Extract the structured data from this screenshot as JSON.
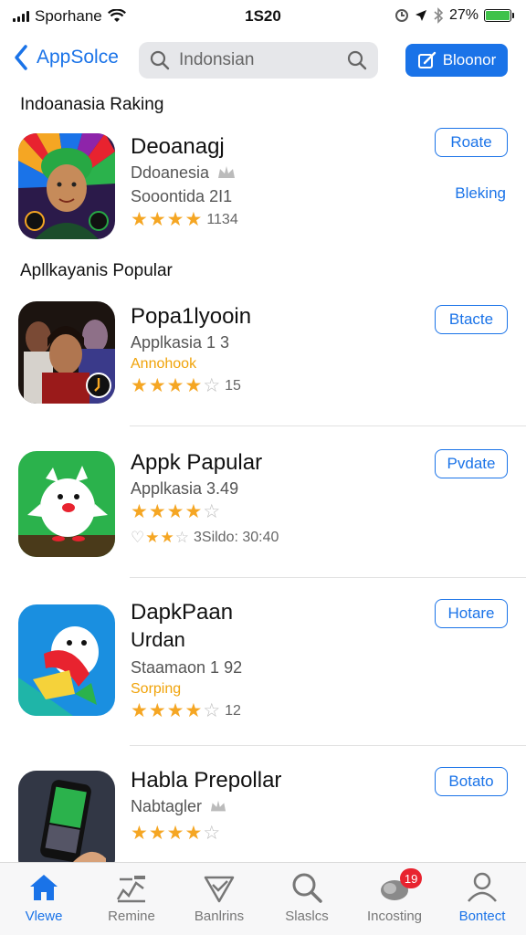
{
  "status_bar": {
    "carrier": "Sporhane",
    "time": "1S20",
    "battery_percent": "27%"
  },
  "nav": {
    "back_label": "AppSolce",
    "search_query": "Indonsian",
    "action_button": "Bloonor"
  },
  "sections": {
    "ranking_title": "Indoanasia Raking",
    "popular_title": "Apllkayanis Popular"
  },
  "featured": {
    "title": "Deoanagj",
    "subtitle": "Ddoanesia",
    "meta": "Sooontida 2I1",
    "rating": 4,
    "rating_count": "1134",
    "button": "Roate",
    "side_link": "Bleking"
  },
  "apps": [
    {
      "title": "Popa1lyooin",
      "subtitle": "Applkasia 1 3",
      "tag": "Annohook",
      "rating": 4,
      "rating_count": "15",
      "button": "Btacte"
    },
    {
      "title": "Appk Papular",
      "subtitle": "Applkasia 3.49",
      "rating": 4,
      "extra_rating": 2,
      "extra_text": "3Sildo: 30:40",
      "button": "Pvdate"
    },
    {
      "title": "DapkPaan",
      "title2": "Urdan",
      "subtitle": "Staamaon 1 92",
      "tag": "Sorping",
      "rating": 4,
      "rating_count": "12",
      "button": "Hotare"
    },
    {
      "title": "Habla Prepollar",
      "subtitle": "Nabtagler",
      "rating": 4,
      "button": "Botato"
    }
  ],
  "tabs": [
    {
      "label": "Vlewe",
      "icon": "home-icon",
      "active": true
    },
    {
      "label": "Remine",
      "icon": "pencil-chart-icon"
    },
    {
      "label": "Banlrins",
      "icon": "checkmark-icon"
    },
    {
      "label": "Slaslcs",
      "icon": "search-icon"
    },
    {
      "label": "Incosting",
      "icon": "cloud-icon",
      "badge": "19"
    },
    {
      "label": "Bontect",
      "icon": "person-icon",
      "highlight": true
    }
  ],
  "colors": {
    "accent": "#1a73e8",
    "star": "#f5a623",
    "tag": "#f0a30a",
    "badge": "#e8232f"
  }
}
